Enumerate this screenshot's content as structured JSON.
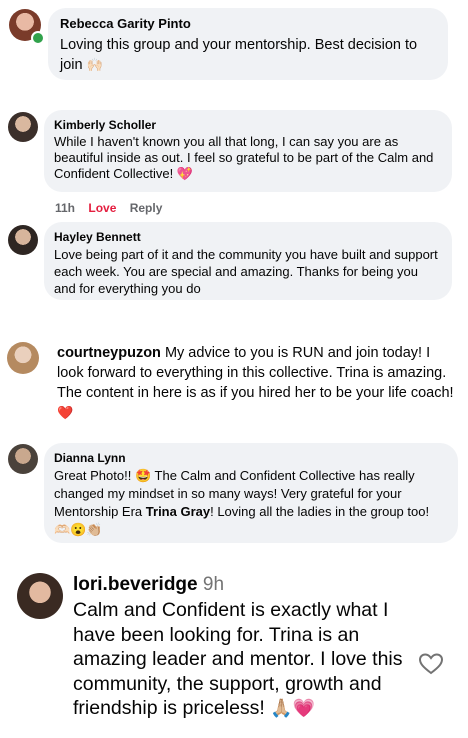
{
  "comments": [
    {
      "name": "Rebecca Garity Pinto",
      "text": "Loving this group and your mentorship. Best decision to join",
      "emoji": "🙌🏻"
    },
    {
      "name": "Kimberly Scholler",
      "text": "While I haven't known you all that long, I can say you are as beautiful inside as out. I feel so grateful to be part of the Calm and Confident Collective!",
      "emoji": "💖",
      "meta": {
        "time": "11h",
        "love": "Love",
        "reply": "Reply"
      }
    },
    {
      "name": "Hayley Bennett",
      "text": "Love being part of it and the community you have built and support each week. You are special and amazing. Thanks for being you and for everything you do"
    },
    {
      "name": "courtneypuzon",
      "text": "My advice to you is RUN and join today! I look forward to everything in this collective. Trina is amazing. The content in here is as if you hired her to be your life coach!",
      "emoji": "❤️"
    },
    {
      "name": "Dianna Lynn",
      "text_a": "Great Photo!!",
      "emoji_a": "🤩",
      "text_b": "The Calm and Confident Collective has really changed my mindset in so many ways! Very grateful for your Mentorship Era",
      "bold": "Trina Gray",
      "text_c": "! Loving all the ladies in the group too!",
      "emoji_c": "🫶🏻😮👏🏼"
    },
    {
      "name": "lori.beveridge",
      "time": "9h",
      "text": "Calm and Confident is exactly what I have been looking for. Trina is an amazing leader and mentor. I love this community, the support, growth and friendship is priceless!",
      "emoji": "🙏🏼💗"
    }
  ],
  "icons": {
    "like": "heart-outline-icon"
  },
  "colors": {
    "bubble": "#f0f2f5",
    "love": "#e41e3f",
    "meta": "#65676b",
    "online": "#31a24c"
  }
}
